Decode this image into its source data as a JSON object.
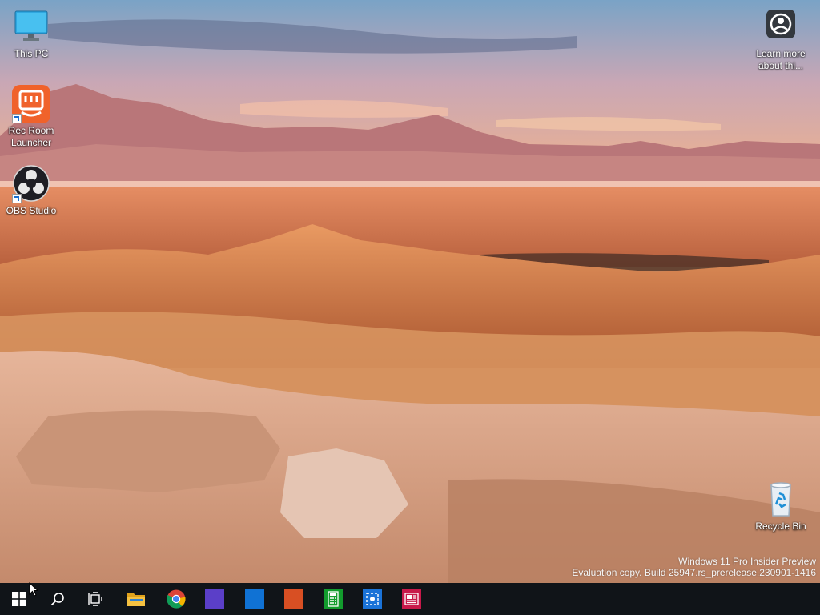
{
  "desktop": {
    "icons": [
      {
        "label": "This PC",
        "icon": "monitor-icon"
      },
      {
        "label": "Rec Room Launcher",
        "icon": "rec-room-icon"
      },
      {
        "label": "OBS Studio",
        "icon": "obs-icon"
      },
      {
        "label": "Learn more about thi...",
        "icon": "learn-more-icon"
      },
      {
        "label": "Recycle Bin",
        "icon": "recycle-bin-icon"
      }
    ],
    "watermark": {
      "line1": "Windows 11 Pro Insider Preview",
      "line2": "Evaluation copy. Build 25947.rs_prerelease.230901-1416"
    }
  },
  "taskbar": {
    "background": "#101418",
    "items": [
      {
        "name": "start",
        "icon": "windows-logo-icon"
      },
      {
        "name": "search",
        "icon": "search-icon"
      },
      {
        "name": "task-view",
        "icon": "task-view-icon"
      },
      {
        "name": "file-explorer",
        "icon": "folder-icon",
        "color": "#f5c141"
      },
      {
        "name": "chrome",
        "icon": "chrome-icon"
      },
      {
        "name": "app-purple",
        "icon": "purple-tile-icon",
        "color": "#5b3fc8"
      },
      {
        "name": "app-blue",
        "icon": "blue-tile-icon",
        "color": "#1072d4"
      },
      {
        "name": "app-orange",
        "icon": "orange-tile-icon",
        "color": "#d84f23"
      },
      {
        "name": "calculator",
        "icon": "calculator-icon",
        "color": "#129c2d"
      },
      {
        "name": "app-screenshot",
        "icon": "screenshot-tile-icon",
        "color": "#1a73d8"
      },
      {
        "name": "app-news",
        "icon": "news-tile-icon",
        "color": "#c8194a"
      }
    ]
  }
}
